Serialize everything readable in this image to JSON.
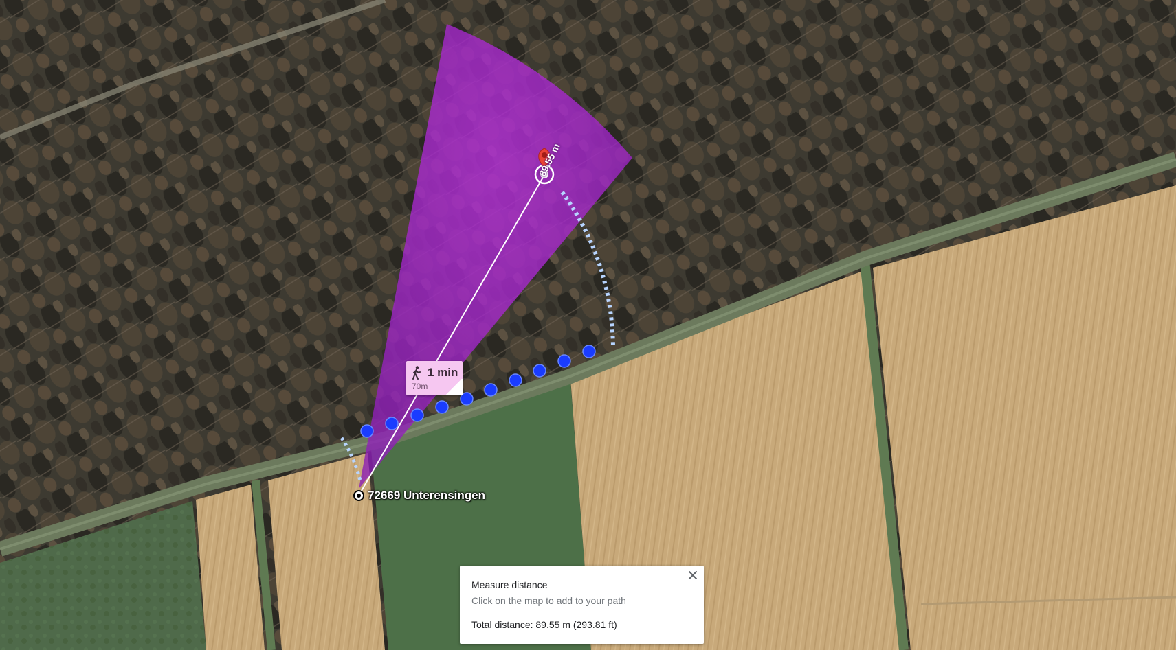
{
  "map": {
    "view": "satellite",
    "place_label": "72669 Unterensingen",
    "segment_distance_label": "89.55 m",
    "start_marker_icon": "start-point-icon",
    "end_marker_icon": "red-location-pin-icon",
    "path_color": "#ffffff",
    "cone_color": "#b22ad8",
    "waypoint_color": "#1a3cff",
    "guide_arc_color": "#b7d4ff"
  },
  "walk_callout": {
    "icon": "walking-person-icon",
    "time": "1 min",
    "distance": "70m"
  },
  "measure_panel": {
    "title": "Measure distance",
    "hint": "Click on the map to add to your path",
    "total": "Total distance: 89.55 m (293.81 ft)",
    "close_icon": "close-icon"
  }
}
